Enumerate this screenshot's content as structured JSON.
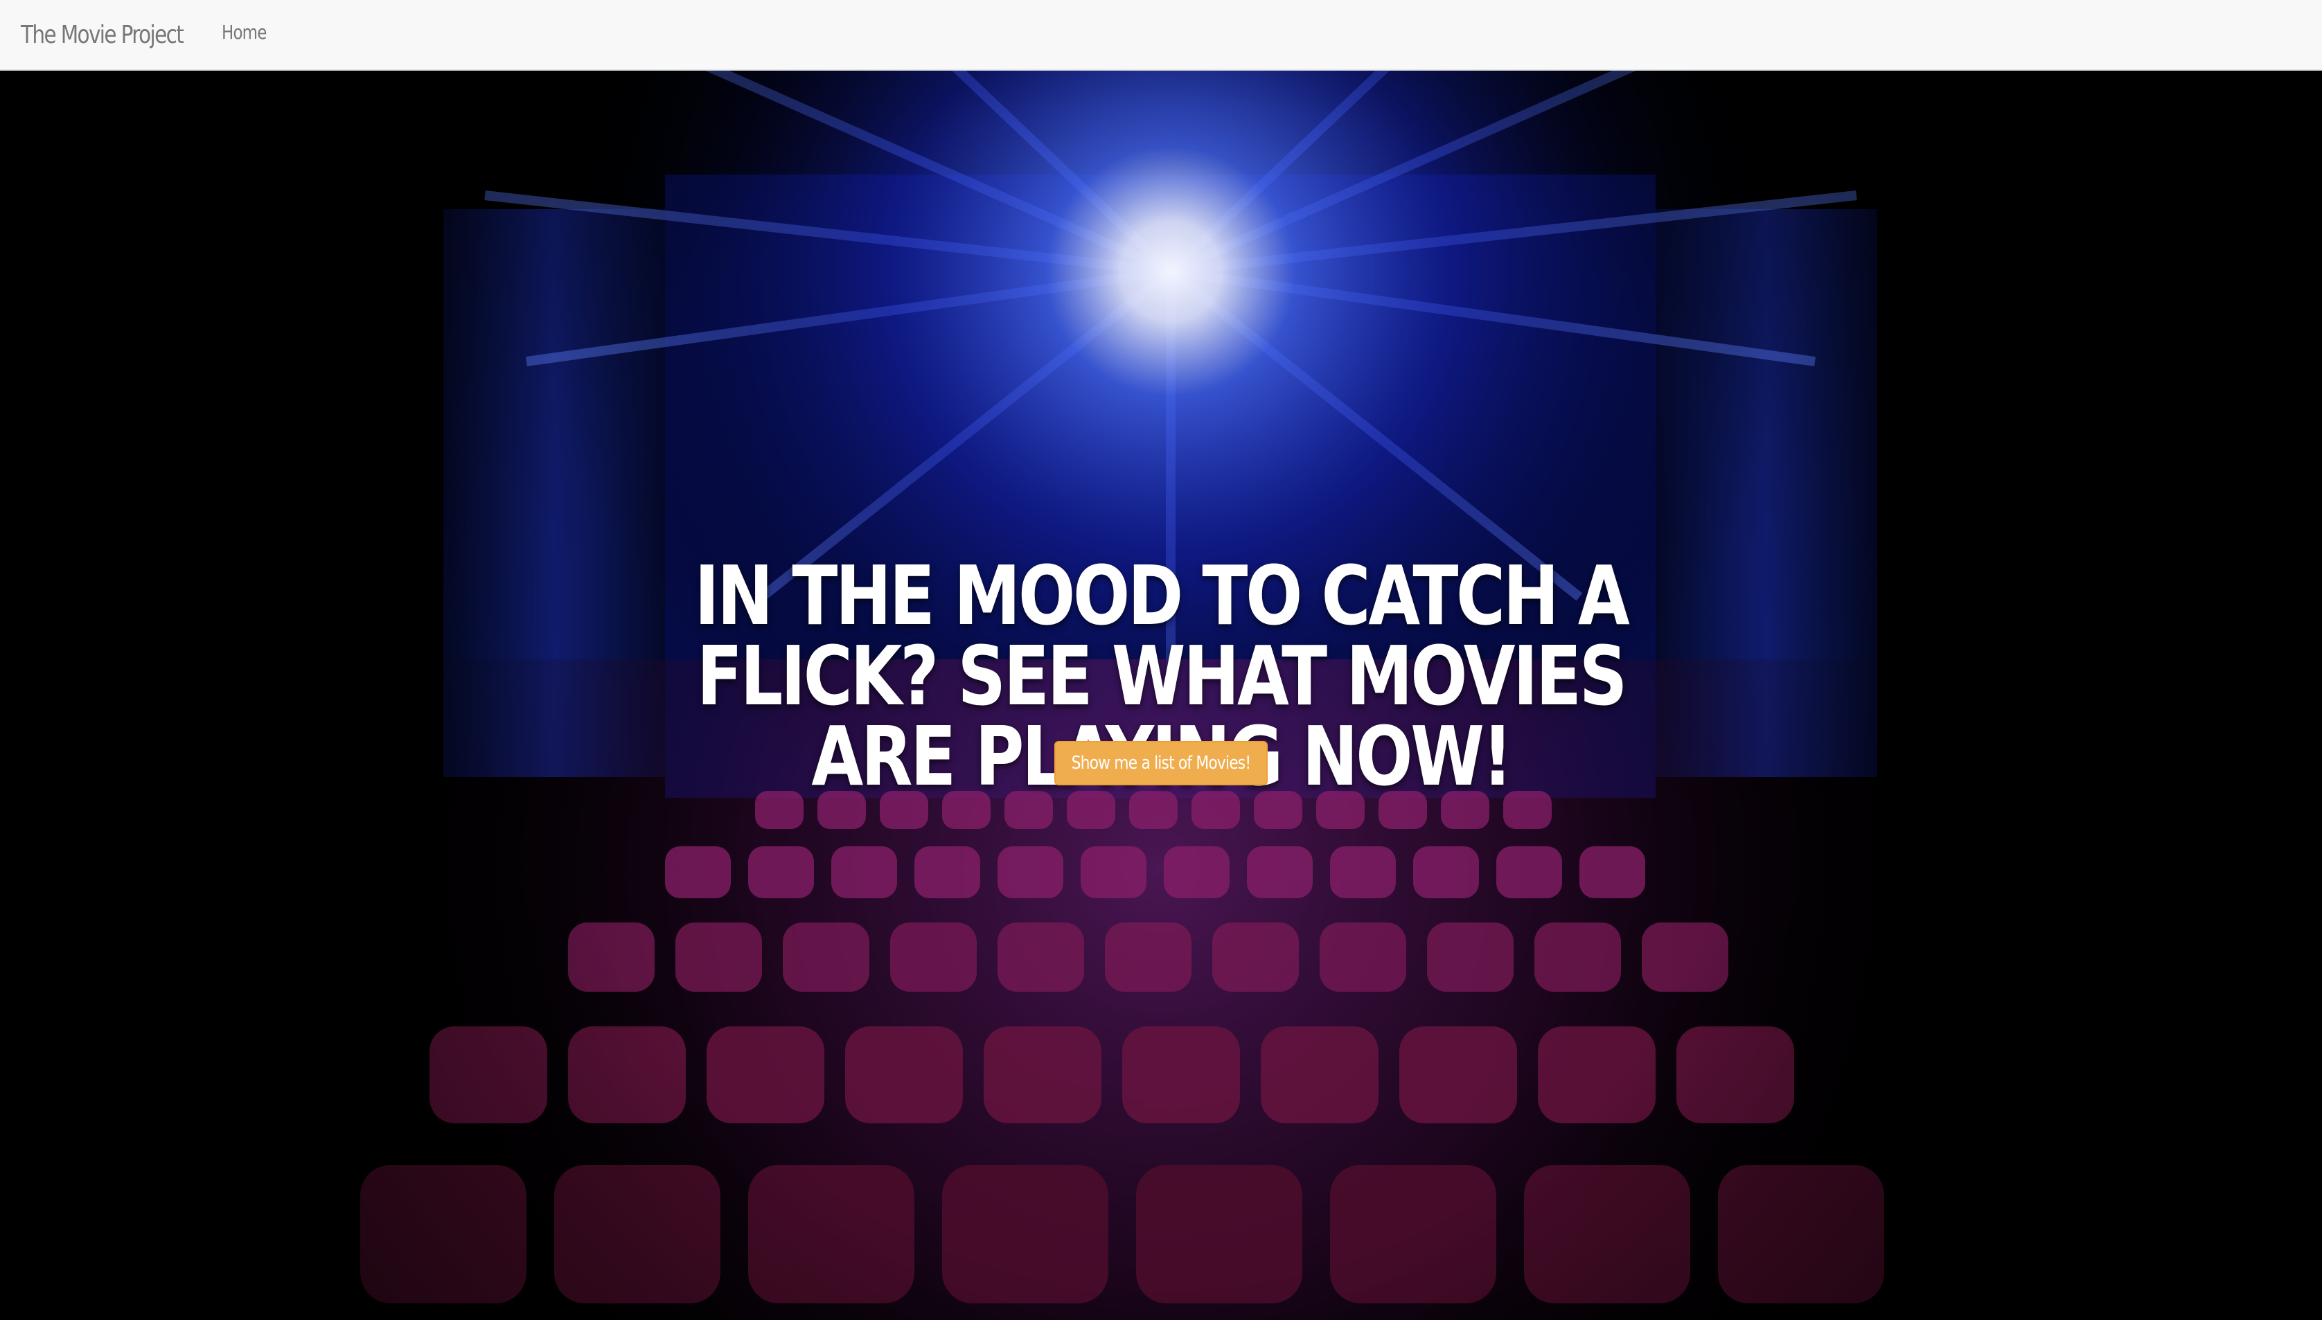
{
  "navbar": {
    "brand": "The Movie Project",
    "links": [
      {
        "label": "Home"
      }
    ]
  },
  "hero": {
    "headline": "IN THE MOOD TO CATCH A FLICK? SEE WHAT MOVIES ARE PLAYING NOW!",
    "cta_label": "Show me a list of Movies!",
    "background_image": "movie-theater-seats-with-blue-projector-light"
  },
  "colors": {
    "navbar_bg": "#f8f8f8",
    "nav_text": "#777777",
    "cta_bg": "#f0ad4e",
    "headline": "#ffffff"
  }
}
